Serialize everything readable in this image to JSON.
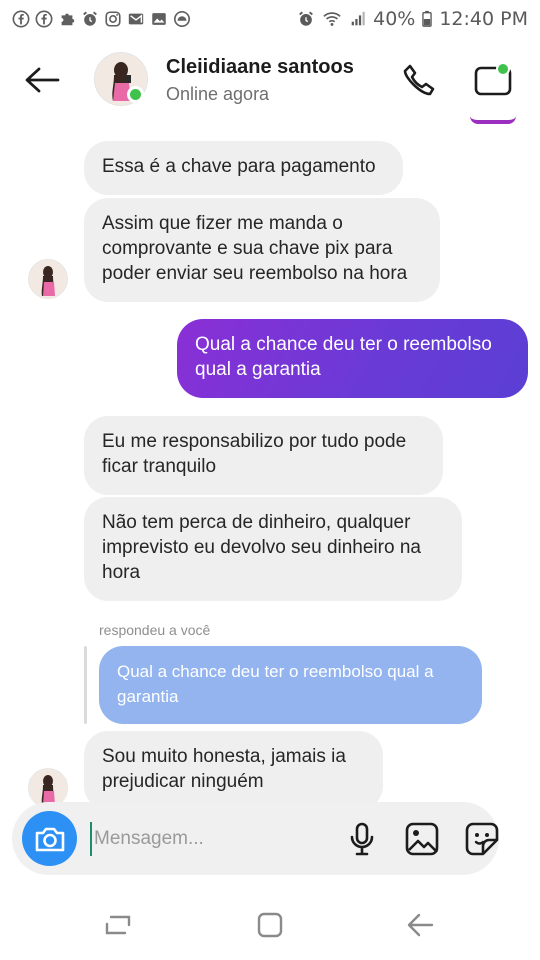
{
  "status_bar": {
    "left_icons": [
      "facebook-icon",
      "facebook-icon",
      "puzzle-icon",
      "alarm-icon",
      "instagram-icon",
      "gmail-icon",
      "gallery-icon",
      "dashboard-icon"
    ],
    "battery": "40%",
    "time": "12:40 PM"
  },
  "header": {
    "contact_name": "Cleiidiaane santoos",
    "contact_status": "Online agora"
  },
  "messages": [
    {
      "side": "in",
      "text": "Essa é a chave para pagamento"
    },
    {
      "side": "in",
      "text": "Assim que fizer me manda o\ncomprovante e sua chave pix para\npoder enviar seu reembolso na hora"
    },
    {
      "side": "out",
      "text": "Qual a chance deu ter o reembolso\nqual a garantia"
    },
    {
      "side": "in",
      "text": "Eu me responsabilizo por tudo pode\nficar tranquilo"
    },
    {
      "side": "in",
      "text": "Não tem perca de dinheiro,  qualquer\nimprevisto eu devolvo seu dinheiro na\nhora"
    },
    {
      "side": "in",
      "reply_label": "respondeu a você",
      "quoted": "Qual a chance deu ter o reembolso qual a\ngarantia",
      "text": "Sou muito honesta, jamais ia\nprejudicar ninguém"
    }
  ],
  "composer": {
    "placeholder": "Mensagem...",
    "value": ""
  },
  "colors": {
    "outgoing_bubble": "#7a35d6",
    "incoming_bubble": "#efefef",
    "quoted_bubble": "#93b4ef",
    "online": "#3fc24c",
    "camera": "#2d90f5"
  }
}
